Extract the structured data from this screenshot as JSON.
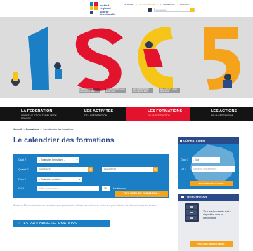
{
  "header": {
    "logo_text": [
      "institut",
      "régional",
      "sportif",
      "et culturelle"
    ],
    "links": [
      "INTRANET",
      "SE CONNECTER",
      "FACEBOOK",
      "CONTACT"
    ],
    "search_placeholder": "Rechercher..."
  },
  "hero": {
    "captions": [
      "LA FÉDÉRATION Lorem ipsum dolor",
      "LES ACTIVITÉS Lorem ipsum dolor",
      "LES FORMATIONS Lorem ipsum dolor",
      "LES ACTIONS Lorem ipsum dolor"
    ],
    "colors": {
      "blue": "#1a7fc4",
      "red": "#e3132d",
      "yellow": "#f5c518",
      "orange": "#f5a31a"
    }
  },
  "nav": [
    {
      "title": "LA FÉDÉRATION",
      "sub": "SPORTIVE ET CULTURELLE DE FRANCE"
    },
    {
      "title": "LES ACTIVITÉS",
      "sub": "DE LA FÉDÉRATION"
    },
    {
      "title": "LES FORMATIONS",
      "sub": "DE LA FÉDÉRATION"
    },
    {
      "title": "LES ACTIONS",
      "sub": "DE LA FÉDÉRATION"
    }
  ],
  "breadcrumb": {
    "home": "Accueil",
    "section": "Formations",
    "current": "Le calendrier des formations",
    "sep": ">"
  },
  "page_title": "Le calendrier des formations",
  "form": {
    "quoi_label": "Quoi ?",
    "quoi_value": "- Toutes les formations -",
    "quand_label": "Quand ?",
    "date_from": "08/03/2022",
    "date_to": "08/03/2024",
    "pour_label": "Pour ?",
    "pour_value": "- Toutes les activités -",
    "ou_label": "Où ?",
    "ou_placeholder": "Ville, code postal",
    "km_value": "15",
    "km_label": "km alentour",
    "submit": "TROUVER UNE FORMATION"
  },
  "intro": "Seuls les 50 premiers lieux de formation sont géolocalisés. Affinez vos critères de recherche pour afficher les plus pertinents sur la carte.",
  "section_banner": {
    "hash": "//",
    "label": "LES PROCHAINES FORMATIONS"
  },
  "where": {
    "title": "OÙ PRATIQUER",
    "quoi_label": "Quoi ?",
    "quoi_value": "- Tout -",
    "ou_label": "Où ?",
    "ou_placeholder": "Saisissez une adresse...",
    "button": "TROUVER UNE ACTIVITÉ"
  },
  "doc": {
    "title": "WEBOTHÈQUE",
    "text": "Tous les documents sont à disposition dans la webothèque",
    "button": "TROUVER UN DOCUMENT"
  }
}
